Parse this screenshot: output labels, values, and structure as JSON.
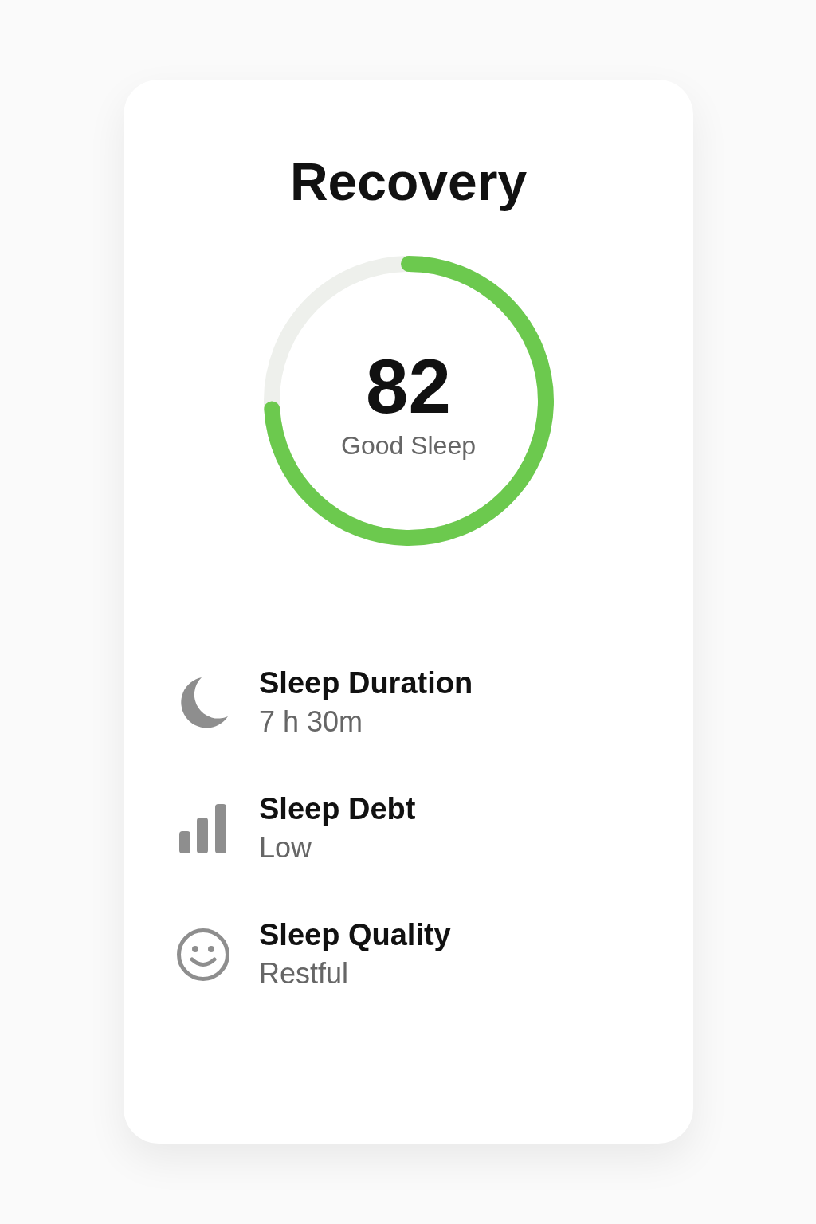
{
  "title": "Recovery",
  "score": {
    "value": "82",
    "label": "Good Sleep"
  },
  "metrics": [
    {
      "kind": "moon",
      "title": "Sleep Duration",
      "value": "7 h 30m"
    },
    {
      "kind": "bars",
      "title": "Sleep Debt",
      "value": "Low"
    },
    {
      "kind": "smile",
      "title": "Sleep Quality",
      "value": "Restful"
    }
  ]
}
